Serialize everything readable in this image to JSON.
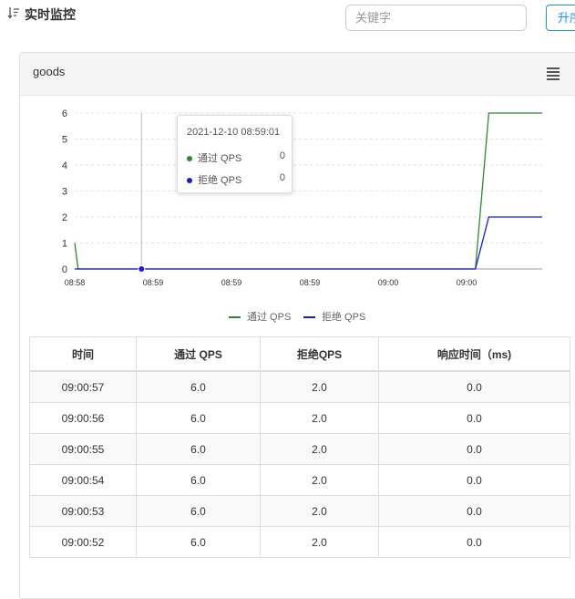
{
  "header": {
    "title": "实时监控",
    "sort_label": "升序"
  },
  "search": {
    "placeholder": "关键字"
  },
  "panel": {
    "title": "goods"
  },
  "chart_data": {
    "type": "line",
    "y_ticks": [
      "6",
      "5",
      "4",
      "3",
      "2",
      "1",
      "0"
    ],
    "x_ticks": [
      "08:58",
      "08:59",
      "08:59",
      "08:59",
      "09:00",
      "09:00"
    ],
    "ylim": [
      0,
      6
    ],
    "x_range_seconds": [
      0,
      140
    ],
    "series": [
      {
        "name": "通过 QPS",
        "color": "#2b8a2b",
        "points": [
          [
            0,
            1
          ],
          [
            1,
            0
          ],
          [
            120,
            0
          ],
          [
            124,
            6
          ],
          [
            140,
            6
          ]
        ]
      },
      {
        "name": "拒绝 QPS",
        "color": "#1a1adb",
        "points": [
          [
            0,
            0
          ],
          [
            120,
            0
          ],
          [
            124,
            2
          ],
          [
            140,
            2
          ]
        ]
      }
    ],
    "cursor": {
      "x": 20,
      "y": 0
    },
    "grid": true,
    "legend_position": "bottom"
  },
  "tooltip": {
    "time": "2021-12-10 08:59:01",
    "rows": [
      {
        "label": "通过 QPS",
        "value": "0",
        "color": "#2b8a2b"
      },
      {
        "label": "拒绝 QPS",
        "value": "0",
        "color": "#1a1adb"
      }
    ]
  },
  "legend": [
    {
      "label": "通过 QPS",
      "color": "#2b8a2b"
    },
    {
      "label": "拒绝 QPS",
      "color": "#1a1adb"
    }
  ],
  "table": {
    "headers": [
      "时间",
      "通过 QPS",
      "拒绝QPS",
      "响应时间（ms)"
    ],
    "rows": [
      [
        "09:00:57",
        "6.0",
        "2.0",
        "0.0"
      ],
      [
        "09:00:56",
        "6.0",
        "2.0",
        "0.0"
      ],
      [
        "09:00:55",
        "6.0",
        "2.0",
        "0.0"
      ],
      [
        "09:00:54",
        "6.0",
        "2.0",
        "0.0"
      ],
      [
        "09:00:53",
        "6.0",
        "2.0",
        "0.0"
      ],
      [
        "09:00:52",
        "6.0",
        "2.0",
        "0.0"
      ]
    ]
  }
}
